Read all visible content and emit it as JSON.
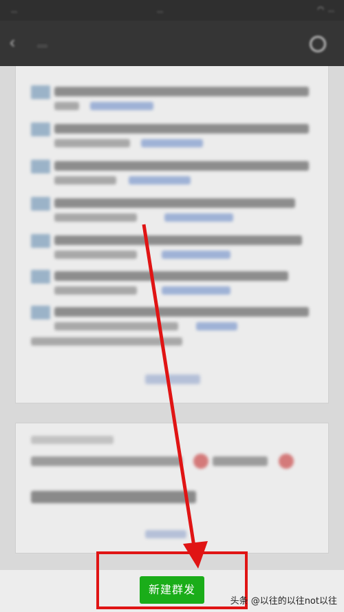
{
  "status_bar": {
    "carrier": "...",
    "time": "...",
    "battery": "..."
  },
  "header": {
    "title": "...",
    "back_icon": "back-arrow-icon",
    "more_icon": "more-icon"
  },
  "footer": {
    "new_broadcast_button": "新建群发"
  },
  "watermark": {
    "text": "头条 @以往的以往not以往"
  },
  "annotation": {
    "highlight_color": "#e01414",
    "button_color": "#1aad19"
  }
}
